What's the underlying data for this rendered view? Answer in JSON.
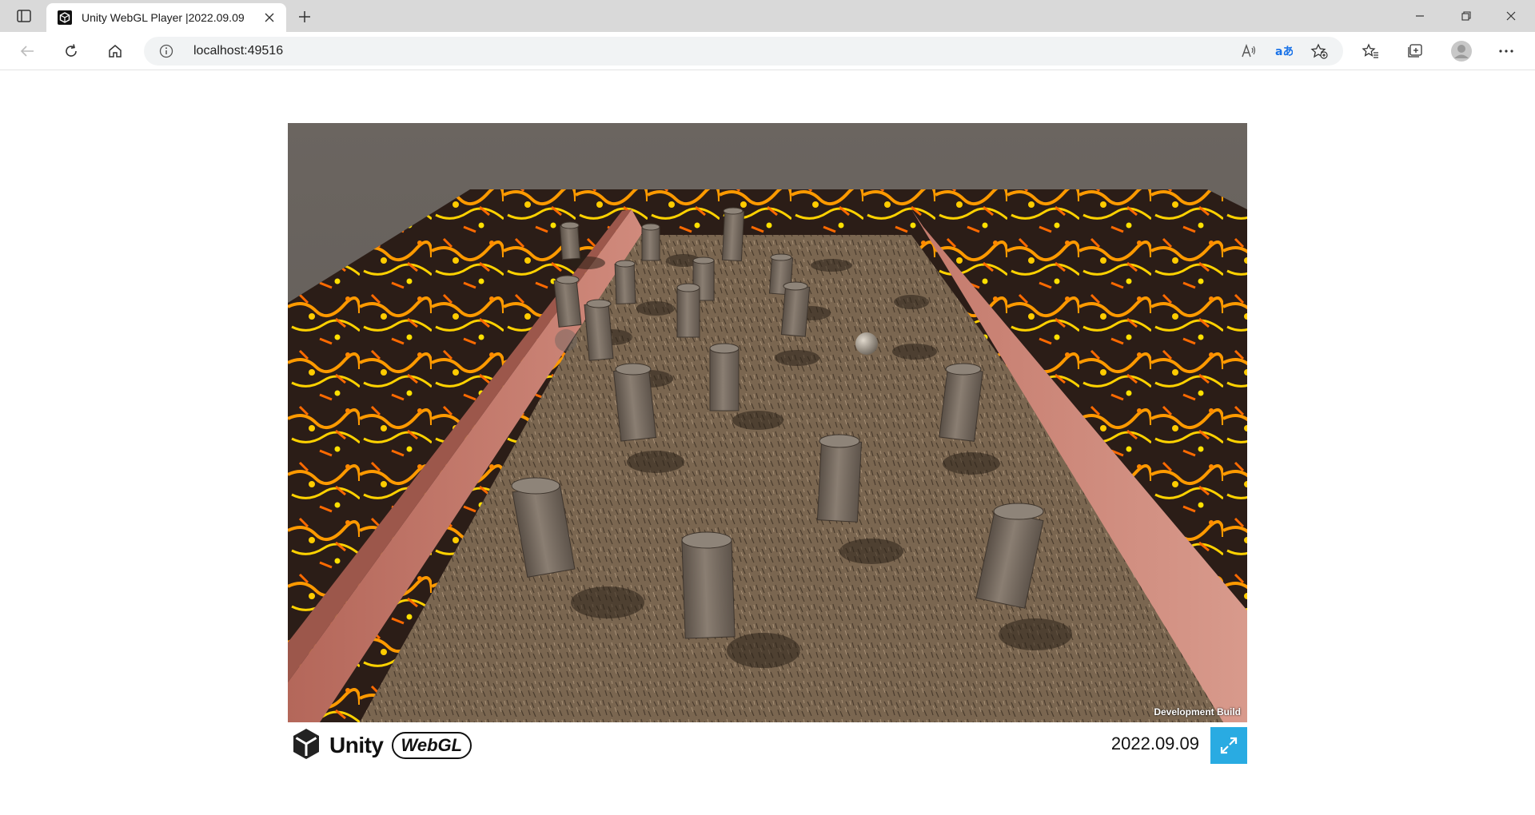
{
  "browser": {
    "tab_title": "Unity WebGL Player |2022.09.09",
    "url": "localhost:49516"
  },
  "page": {
    "dev_build_label": "Development Build",
    "footer_logo_text": "Unity",
    "footer_webgl_text": "WebGL",
    "build_title": "2022.09.09"
  },
  "colors": {
    "fullscreen_button": "#29abe2",
    "lava_bright": "#ffcc00",
    "lava_dark": "#2a1a14",
    "wall": "#c0705f",
    "ground": "#7a6650"
  }
}
